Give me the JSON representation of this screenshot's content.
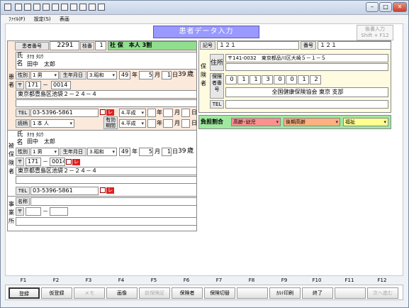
{
  "window": {
    "menu": [
      "ﾌｧｲﾙ(F)",
      "設定(S)",
      "表画"
    ],
    "title": "患者データ入力",
    "side_button": [
      "後書入力",
      "Shift + F12"
    ]
  },
  "patient": {
    "number_label": "患者番号",
    "number": "2291",
    "branch_label": "枝番",
    "branch": "1",
    "insurance": "社 保　本人 3割",
    "name_label": "氏名",
    "kana": "ﾀﾅｶ ﾀﾛｳ",
    "name": "田中　太郎",
    "sex_label": "性別",
    "sex": "1 男",
    "birth_label": "生年月日",
    "era": "3.昭和",
    "year": "49",
    "nen": "年",
    "month": "5",
    "gatsu": "月",
    "day": "1",
    "nichi": "日",
    "age": "39",
    "sai": "歳",
    "postal_mark": "〒",
    "postal1": "171",
    "dash": "－",
    "postal2": "0014",
    "address": "東京都豊島区池袋２－２４－４",
    "tel_label": "TEL",
    "tel": "03-5396-5861",
    "check": "レ",
    "validity_label": "有効期間",
    "validity_from": "4.平成",
    "validity_to": "4.平成",
    "relation_label": "続柄",
    "relation": "1 本 人",
    "side": "患者"
  },
  "insured": {
    "side": "被保険者",
    "name_label": "氏名",
    "kana": "ﾀﾅｶ ﾀﾛｳ",
    "name": "田中　太郎",
    "sex_label": "性別",
    "sex": "1 男",
    "birth_label": "生年月日",
    "era": "3.昭和",
    "year": "49",
    "month": "5",
    "day": "1",
    "age": "39",
    "postal1": "171",
    "postal2": "0014",
    "check": "レ",
    "address": "東京都豊島区池袋２－２４－４",
    "tel_label": "TEL",
    "tel": "03-5396-5861",
    "check2": "レ"
  },
  "business": {
    "side": "事業所",
    "name_label": "名称",
    "postal_mark": "〒",
    "dash": "－"
  },
  "right": {
    "symbol_label": "記号",
    "symbol": "１２１",
    "number_label": "番号",
    "number": "１２１",
    "side": "保険者",
    "addr_label": "住所",
    "addr": "〒141-0032　東京都品川区大崎５－１－５",
    "insurer_num_label": "保険者番号",
    "insurer_digits": [
      "0",
      "1",
      "1",
      "3",
      "0",
      "0",
      "1",
      "2"
    ],
    "name_label": "名称",
    "insurer_name": "全国健康保険協会 東京 支部",
    "tel_label": "TEL",
    "burden_label": "負担割合",
    "burden_child": "高齢･幼児",
    "burden_elder": "後期高齢",
    "burden_welfare": "福祉"
  },
  "fkeys": [
    "F1",
    "F2",
    "F3",
    "F4",
    "F5",
    "F6",
    "F7",
    "F8",
    "F9",
    "F10",
    "F11",
    "F12"
  ],
  "buttons": [
    "登録",
    "仮登録",
    "メモ",
    "画像",
    "前保険証",
    "保険者",
    "保険切替",
    "",
    "ｶﾙﾃ印刷",
    "終了",
    "",
    "次へ進む"
  ]
}
